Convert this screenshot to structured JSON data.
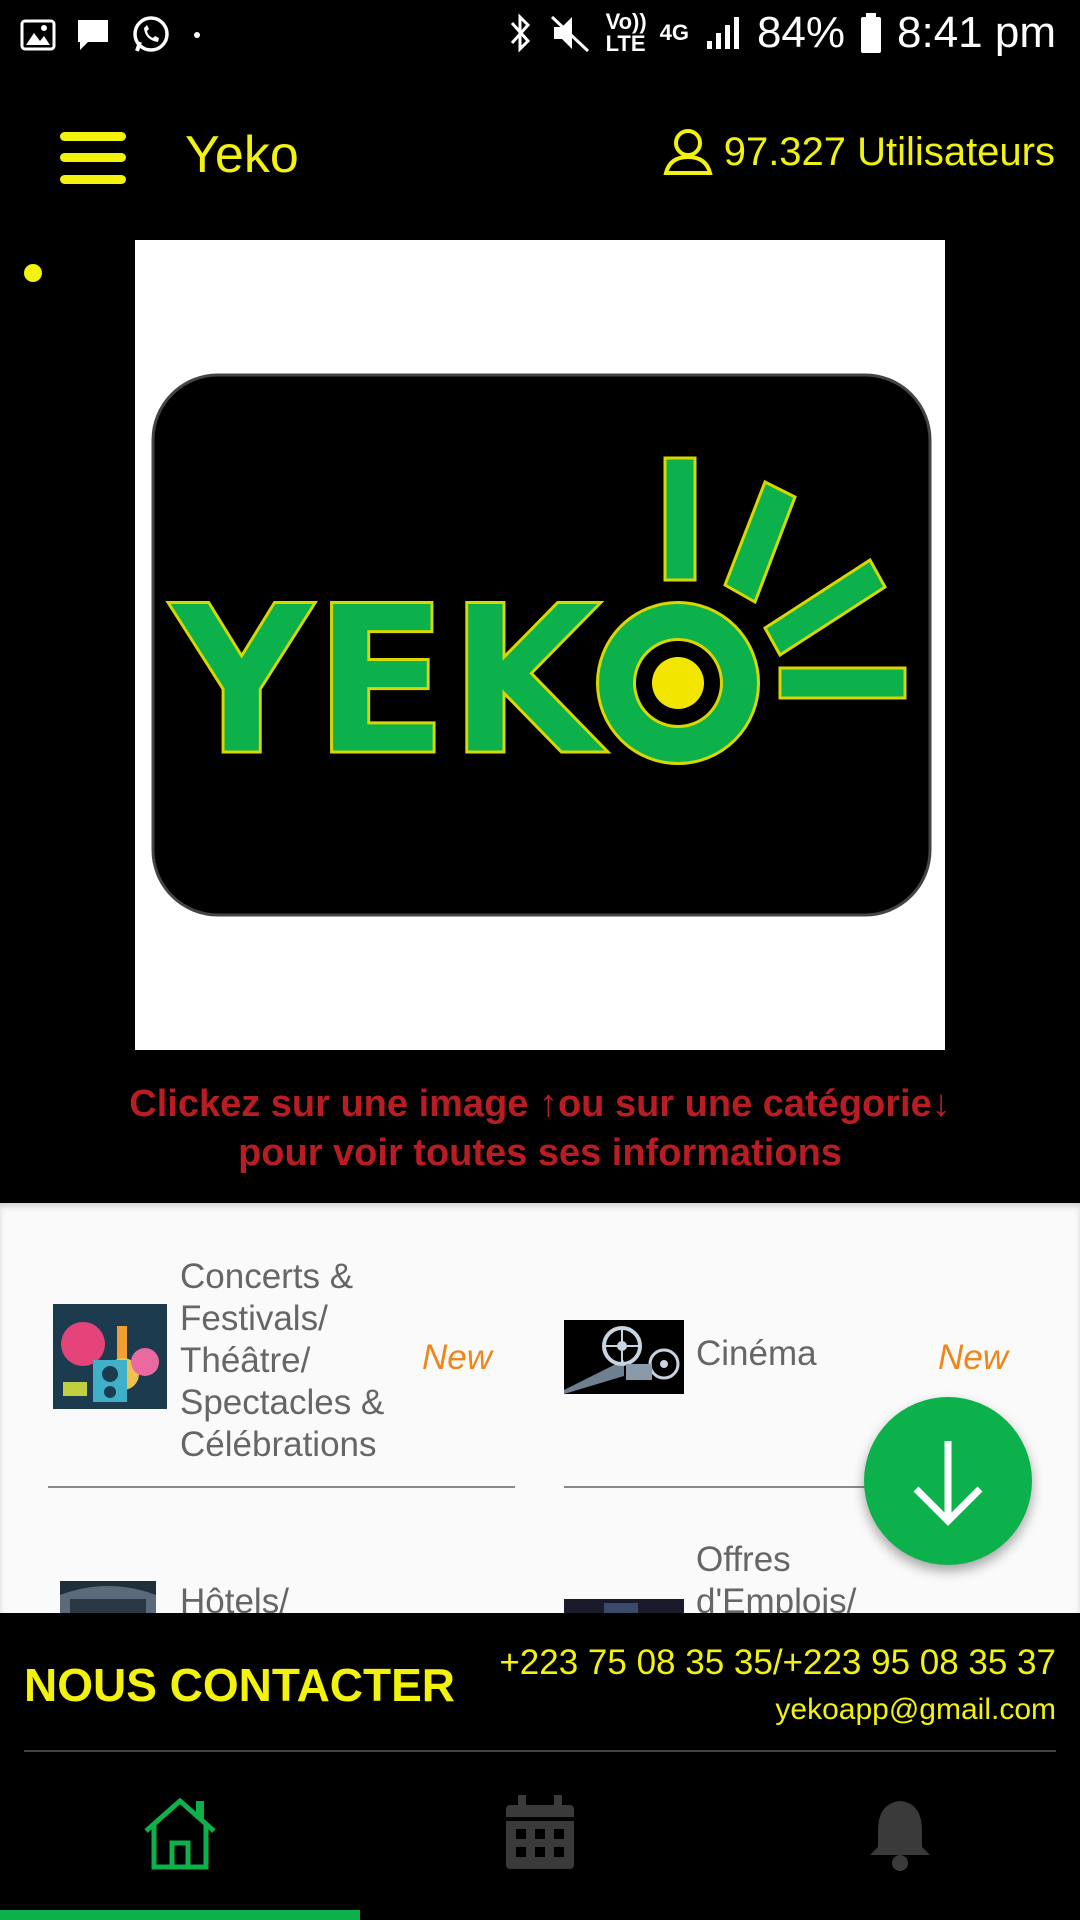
{
  "status_bar": {
    "volte_label": "Vo)) LTE",
    "network_label": "4G",
    "battery": "84%",
    "time": "8:41 pm"
  },
  "app_bar": {
    "title": "Yeko",
    "users_count": "97.327 Utilisateurs"
  },
  "banner": {
    "logo_text": "YEKO"
  },
  "hint": {
    "line1": "Clickez sur une image ↑ou sur  une catégorie↓",
    "line2": "pour voir toutes ses informations"
  },
  "categories": [
    {
      "name_lines": [
        "Concerts &",
        "Festivals/",
        "Théâtre/",
        "Spectacles &",
        "Célébrations"
      ],
      "badge": "New"
    },
    {
      "name_lines": [
        "Cinéma"
      ],
      "badge": "New"
    },
    {
      "name_lines": [
        "Hôtels/"
      ],
      "badge": ""
    },
    {
      "name_lines": [
        "Offres",
        "d'Emplois/"
      ],
      "badge": ""
    }
  ],
  "contact": {
    "title": "NOUS CONTACTER",
    "phone": "+223 75 08 35 35/+223 95 08 35 37",
    "email": "yekoapp@gmail.com"
  },
  "colors": {
    "accent_yellow": "#f2f20d",
    "brand_green": "#0db14b",
    "hint_red": "#b81d24",
    "badge_orange": "#f0851a"
  },
  "icons": [
    "image-icon",
    "message-icon",
    "whatsapp-icon",
    "bluetooth-icon",
    "mute-icon",
    "signal-icon",
    "battery-icon",
    "menu-icon",
    "user-icon",
    "arrow-down-icon",
    "home-icon",
    "calendar-icon",
    "bell-icon"
  ]
}
